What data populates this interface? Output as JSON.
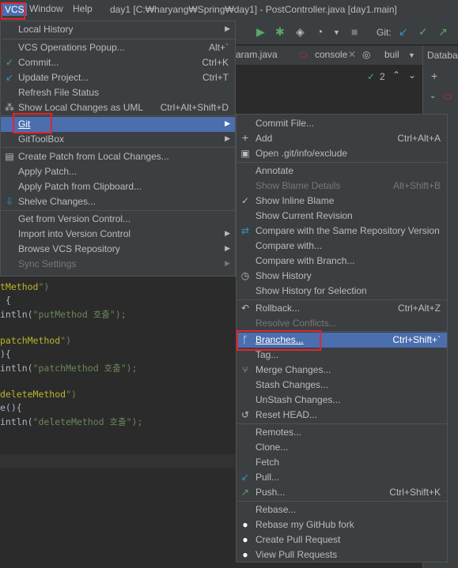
{
  "titlebar": {
    "menus": [
      "VCS",
      "Window",
      "Help"
    ],
    "title": "day1 [C:₩haryang₩Spring₩day1] - PostController.java [day1.main]"
  },
  "toolbar": {
    "git_label": "Git:",
    "problems_count": "2"
  },
  "tabs": [
    "aram.java",
    "console",
    "buil"
  ],
  "right_panel": {
    "label": "Databa"
  },
  "vcs_menu": {
    "items": [
      {
        "label": "Local History",
        "shortcut": "",
        "submenu": true,
        "icon": ""
      },
      {
        "label": "VCS Operations Popup...",
        "shortcut": "Alt+`",
        "icon": ""
      },
      {
        "label": "Commit...",
        "shortcut": "Ctrl+K",
        "icon": "check-icon"
      },
      {
        "label": "Update Project...",
        "shortcut": "Ctrl+T",
        "icon": "update-arrow-icon"
      },
      {
        "label": "Refresh File Status",
        "shortcut": "",
        "icon": ""
      },
      {
        "label": "Show Local Changes as UML",
        "shortcut": "Ctrl+Alt+Shift+D",
        "icon": "uml-icon"
      },
      {
        "label": "Git",
        "shortcut": "",
        "submenu": true,
        "icon": ""
      },
      {
        "label": "GitToolBox",
        "shortcut": "",
        "submenu": true,
        "icon": ""
      },
      {
        "label": "Create Patch from Local Changes...",
        "shortcut": "",
        "icon": "patch-icon"
      },
      {
        "label": "Apply Patch...",
        "shortcut": "",
        "icon": ""
      },
      {
        "label": "Apply Patch from Clipboard...",
        "shortcut": "",
        "icon": ""
      },
      {
        "label": "Shelve Changes...",
        "shortcut": "",
        "icon": "shelve-icon"
      },
      {
        "label": "Get from Version Control...",
        "shortcut": "",
        "icon": ""
      },
      {
        "label": "Import into Version Control",
        "shortcut": "",
        "submenu": true,
        "icon": ""
      },
      {
        "label": "Browse VCS Repository",
        "shortcut": "",
        "submenu": true,
        "icon": ""
      },
      {
        "label": "Sync Settings",
        "shortcut": "",
        "submenu": true,
        "icon": ""
      }
    ]
  },
  "git_menu": {
    "items": [
      {
        "label": "Commit File...",
        "shortcut": ""
      },
      {
        "label": "Add",
        "shortcut": "Ctrl+Alt+A"
      },
      {
        "label": "Open .git/info/exclude",
        "shortcut": ""
      },
      {
        "label": "Annotate",
        "shortcut": ""
      },
      {
        "label": "Show Blame Details",
        "shortcut": "Alt+Shift+B"
      },
      {
        "label": "Show Inline Blame",
        "shortcut": ""
      },
      {
        "label": "Show Current Revision",
        "shortcut": ""
      },
      {
        "label": "Compare with the Same Repository Version",
        "shortcut": ""
      },
      {
        "label": "Compare with...",
        "shortcut": ""
      },
      {
        "label": "Compare with Branch...",
        "shortcut": ""
      },
      {
        "label": "Show History",
        "shortcut": ""
      },
      {
        "label": "Show History for Selection",
        "shortcut": ""
      },
      {
        "label": "Rollback...",
        "shortcut": "Ctrl+Alt+Z"
      },
      {
        "label": "Resolve Conflicts...",
        "shortcut": ""
      },
      {
        "label": "Branches...",
        "shortcut": "Ctrl+Shift+`"
      },
      {
        "label": "Tag...",
        "shortcut": ""
      },
      {
        "label": "Merge Changes...",
        "shortcut": ""
      },
      {
        "label": "Stash Changes...",
        "shortcut": ""
      },
      {
        "label": "UnStash Changes...",
        "shortcut": ""
      },
      {
        "label": "Reset HEAD...",
        "shortcut": ""
      },
      {
        "label": "Remotes...",
        "shortcut": ""
      },
      {
        "label": "Clone...",
        "shortcut": ""
      },
      {
        "label": "Fetch",
        "shortcut": ""
      },
      {
        "label": "Pull...",
        "shortcut": ""
      },
      {
        "label": "Push...",
        "shortcut": "Ctrl+Shift+K"
      },
      {
        "label": "Rebase...",
        "shortcut": ""
      },
      {
        "label": "Rebase my GitHub fork",
        "shortcut": ""
      },
      {
        "label": "Create Pull Request",
        "shortcut": ""
      },
      {
        "label": "View Pull Requests",
        "shortcut": ""
      }
    ]
  },
  "editor": {
    "lines": [
      {
        "a": "tMethod",
        "b": "\")"
      },
      {
        "a": " {",
        "b": ""
      },
      {
        "a": "intln(",
        "b": "\"putMethod 호출\");"
      },
      {
        "a": "",
        "b": ""
      },
      {
        "a": "patchMethod",
        "b": "\")"
      },
      {
        "a": "){",
        "b": ""
      },
      {
        "a": "intln(",
        "b": "\"patchMethod 호출\");"
      },
      {
        "a": "",
        "b": ""
      },
      {
        "a": "deleteMethod",
        "b": "\")"
      },
      {
        "a": "e(){",
        "b": ""
      },
      {
        "a": "intln(",
        "b": "\"deleteMethod 호출\");"
      }
    ]
  }
}
